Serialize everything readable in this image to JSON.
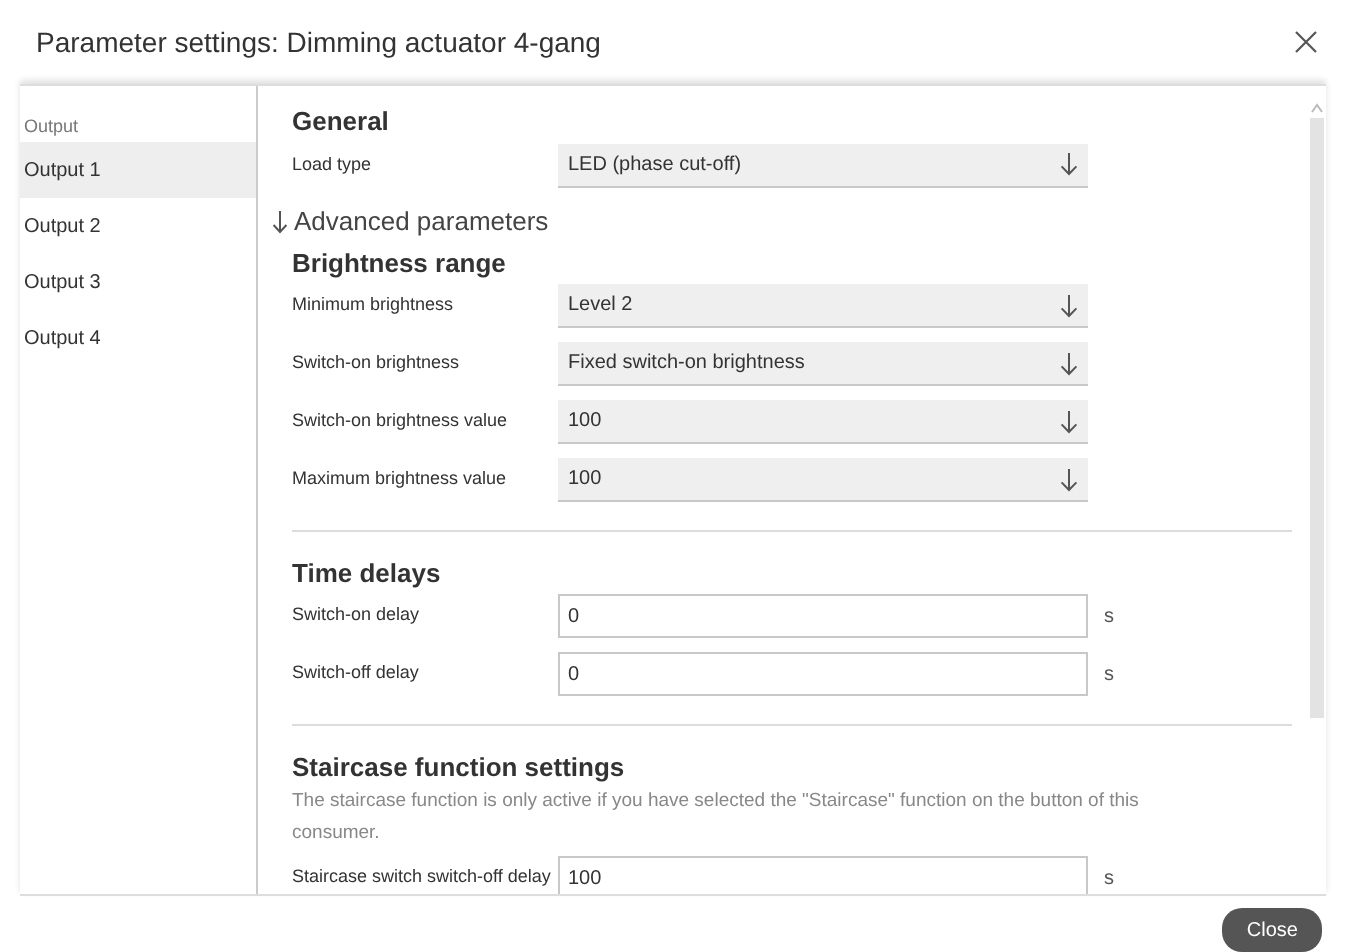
{
  "window": {
    "title": "Parameter settings: Dimming actuator 4-gang"
  },
  "sidebar": {
    "header": "Output",
    "items": [
      {
        "label": "Output 1",
        "selected": true
      },
      {
        "label": "Output 2",
        "selected": false
      },
      {
        "label": "Output 3",
        "selected": false
      },
      {
        "label": "Output 4",
        "selected": false
      }
    ]
  },
  "general": {
    "heading": "General",
    "fields": [
      {
        "kind": "select",
        "label": "Load type",
        "value": "LED (phase cut-off)"
      }
    ]
  },
  "advanced_toggle": {
    "label": "Advanced parameters",
    "expanded": true
  },
  "sections": [
    {
      "heading": "Brightness range",
      "fields": [
        {
          "kind": "select",
          "label": "Minimum brightness",
          "value": "Level 2"
        },
        {
          "kind": "select",
          "label": "Switch-on brightness",
          "value": "Fixed switch-on brightness"
        },
        {
          "kind": "select",
          "label": "Switch-on brightness value",
          "value": "100"
        },
        {
          "kind": "select",
          "label": "Maximum brightness value",
          "value": "100"
        }
      ]
    },
    {
      "heading": "Time delays",
      "fields": [
        {
          "kind": "input",
          "label": "Switch-on delay",
          "value": "0",
          "unit": "s"
        },
        {
          "kind": "input",
          "label": "Switch-off delay",
          "value": "0",
          "unit": "s"
        }
      ]
    },
    {
      "heading": "Staircase function settings",
      "description": "The staircase function is only active if you have selected the \"Staircase\" function on the button of this consumer.",
      "fields": [
        {
          "kind": "input",
          "label": "Staircase switch switch-off delay",
          "value": "100",
          "unit": "s"
        }
      ]
    }
  ],
  "footer": {
    "button": "Close"
  }
}
